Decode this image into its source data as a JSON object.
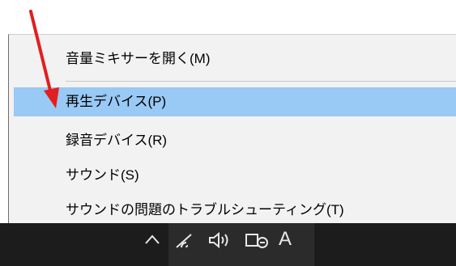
{
  "menu": {
    "items": [
      {
        "label": "音量ミキサーを開く(M)",
        "highlighted": false
      },
      {
        "label": "再生デバイス(P)",
        "highlighted": true
      },
      {
        "label": "録音デバイス(R)",
        "highlighted": false
      },
      {
        "label": "サウンド(S)",
        "highlighted": false
      },
      {
        "label": "サウンドの問題のトラブルシューティング(T)",
        "highlighted": false
      }
    ]
  },
  "taskbar": {
    "tray_icons": [
      "chevron-up-icon",
      "wifi-icon",
      "speaker-icon",
      "keyboard-icon"
    ],
    "ime_label": "A"
  },
  "colors": {
    "menu_bg": "#f2f2f2",
    "highlight": "#99c9f5",
    "taskbar": "#1c1c1c",
    "annotation_arrow": "#e21f1f"
  }
}
